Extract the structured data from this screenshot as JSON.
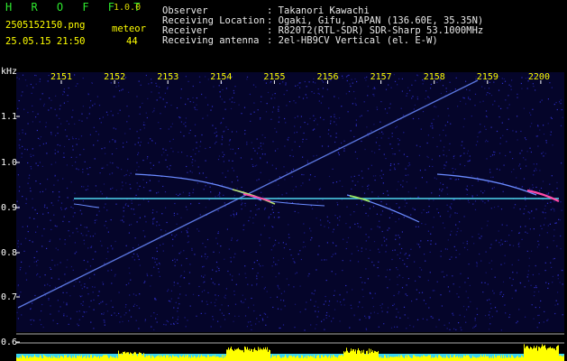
{
  "header": {
    "app_name": "H R O F F T",
    "version": "1.0.0",
    "filename": "2505152150.png",
    "datetime": "25.05.15 21:50",
    "meteor_label": "meteor",
    "meteor_count": "44",
    "info_labels": [
      "Observer",
      "Receiving Location",
      "Receiver",
      "Receiving antenna"
    ],
    "info_values": [
      ": Takanori Kawachi",
      ": Ogaki, Gifu, JAPAN (136.60E, 35.35N)",
      ": R820T2(RTL-SDR) SDR-Sharp 53.1000MHz",
      ": 2el-HB9CV Vertical (el. E-W)"
    ]
  },
  "plot": {
    "y_unit": "kHz",
    "time_labels": [
      "2151",
      "2152",
      "2153",
      "2154",
      "2155",
      "2156",
      "2157",
      "2158",
      "2159",
      "2200"
    ],
    "freq_labels": [
      "1.1",
      "1.0",
      "0.9",
      "0.8",
      "0.7",
      "0.6"
    ],
    "colors": {
      "noise": "#1a1a8a",
      "carrier": "#4fd6f0",
      "trace": "#6a8aff",
      "hot": "#ff4aa8",
      "level": "#ffff00",
      "level_base": "#3ad6f0"
    }
  }
}
